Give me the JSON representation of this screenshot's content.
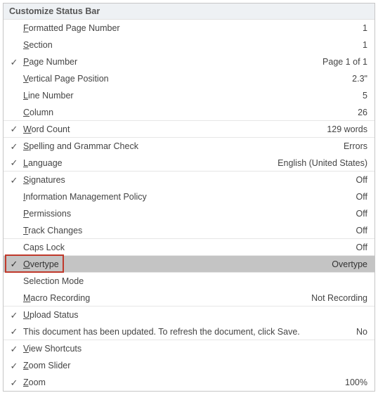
{
  "title": "Customize Status Bar",
  "items": [
    {
      "checked": false,
      "mnemonic": "F",
      "rest": "ormatted Page Number",
      "value": "1",
      "sep": false
    },
    {
      "checked": false,
      "mnemonic": "S",
      "rest": "ection",
      "value": "1",
      "sep": false
    },
    {
      "checked": true,
      "mnemonic": "P",
      "rest": "age Number",
      "value": "Page 1 of 1",
      "sep": false
    },
    {
      "checked": false,
      "mnemonic": "V",
      "rest": "ertical Page Position",
      "value": "2.3\"",
      "sep": false
    },
    {
      "checked": false,
      "mnemonic": "L",
      "rest": "ine Number",
      "value": "5",
      "sep": false
    },
    {
      "checked": false,
      "mnemonic": "C",
      "rest": "olumn",
      "value": "26",
      "sep": true
    },
    {
      "checked": true,
      "mnemonic": "W",
      "rest": "ord Count",
      "value": "129 words",
      "sep": true
    },
    {
      "checked": true,
      "mnemonic": "S",
      "rest": "pelling and Grammar Check",
      "value": "Errors",
      "sep": false
    },
    {
      "checked": true,
      "mnemonic": "L",
      "rest": "anguage",
      "value": "English (United States)",
      "sep": true
    },
    {
      "checked": true,
      "mnemonic": "S",
      "rest": "ignatures",
      "value": "Off",
      "sep": false
    },
    {
      "checked": false,
      "mnemonic": "I",
      "rest": "nformation Management Policy",
      "value": "Off",
      "sep": false
    },
    {
      "checked": false,
      "mnemonic": "P",
      "rest": "ermissions",
      "value": "Off",
      "sep": false
    },
    {
      "checked": false,
      "mnemonic": "T",
      "rest": "rack Changes",
      "value": "Off",
      "sep": true
    },
    {
      "checked": false,
      "mnemonic": "",
      "rest": "Caps Lock",
      "value": "Off",
      "sep": true
    },
    {
      "checked": true,
      "mnemonic": "O",
      "rest": "vertype",
      "value": "Overtype",
      "sep": true,
      "highlighted": true,
      "boxed": true
    },
    {
      "checked": false,
      "mnemonic": "",
      "rest": "Selection Mode",
      "value": "",
      "sep": false
    },
    {
      "checked": false,
      "mnemonic": "M",
      "rest": "acro Recording",
      "value": "Not Recording",
      "sep": true
    },
    {
      "checked": true,
      "mnemonic": "U",
      "rest": "pload Status",
      "value": "",
      "sep": false
    },
    {
      "checked": true,
      "mnemonic": "",
      "rest": "This document has been updated. To refresh the document, click Save.",
      "value": "No",
      "sep": true
    },
    {
      "checked": true,
      "mnemonic": "V",
      "rest": "iew Shortcuts",
      "value": "",
      "sep": false
    },
    {
      "checked": true,
      "mnemonic": "Z",
      "rest": "oom Slider",
      "value": "",
      "sep": false
    },
    {
      "checked": true,
      "mnemonic": "Z",
      "rest": "oom",
      "value": "100%",
      "sep": false
    }
  ]
}
